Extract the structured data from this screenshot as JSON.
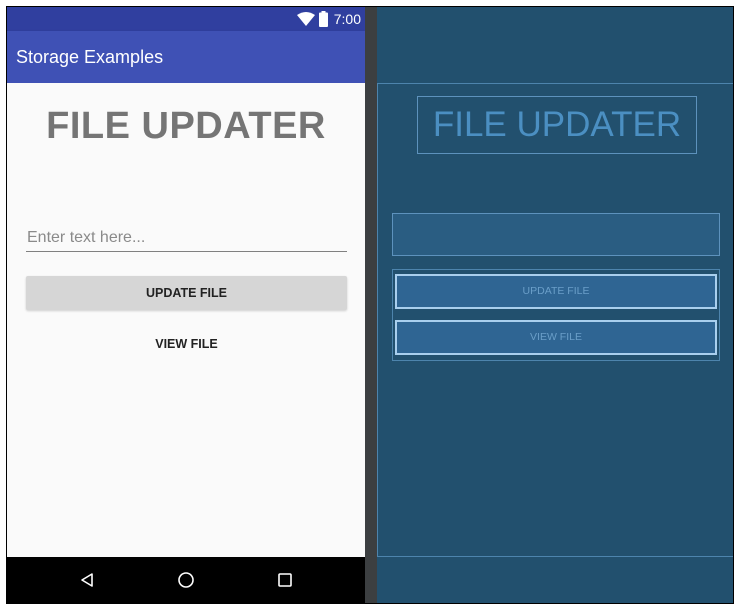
{
  "status_bar": {
    "time": "7:00",
    "icons": [
      "wifi-icon",
      "battery-icon"
    ]
  },
  "app_bar": {
    "title": "Storage Examples"
  },
  "main": {
    "heading": "FILE UPDATER",
    "input": {
      "value": "",
      "placeholder": "Enter text here..."
    },
    "update_button_label": "UPDATE FILE",
    "view_button_label": "VIEW FILE"
  },
  "nav_bar": {
    "icons": [
      "back-triangle-icon",
      "home-circle-icon",
      "recents-square-icon"
    ]
  },
  "blueprint": {
    "heading": "FILE UPDATER",
    "update_button_label": "UPDATE FILE",
    "view_button_label": "VIEW FILE"
  },
  "colors": {
    "status_bar": "#303f9f",
    "app_bar": "#3f51b5",
    "content_bg": "#fafafa",
    "heading_text": "#757575",
    "button_bg": "#d6d6d6",
    "blueprint_bg": "#22506e",
    "blueprint_outline": "#5d92bd",
    "blueprint_text": "#4b8fc2"
  }
}
